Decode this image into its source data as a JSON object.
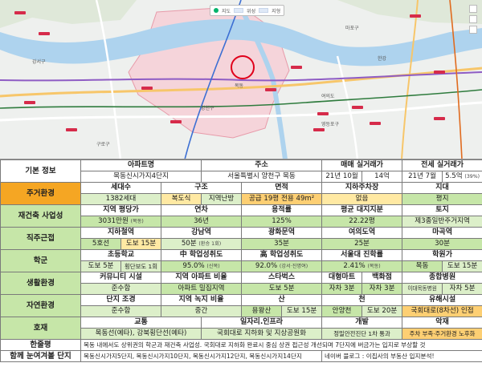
{
  "map": {
    "toolbar": [
      "지도",
      "위성",
      "지형"
    ],
    "labels": [
      "강서구",
      "양천구",
      "영등포구",
      "마포구",
      "구로구",
      "한강",
      "여의도",
      "목동"
    ]
  },
  "table": {
    "basic": {
      "cat": "기본 정보",
      "h_apt": "아파트명",
      "h_addr": "주소",
      "h_sale": "매매 실거래가",
      "h_jeon": "전세 실거래가",
      "apt": "목동신시가지4단지",
      "addr": "서울특별시 양천구 목동",
      "sale_date": "21년 10월",
      "sale_price": "14억",
      "jeon_date": "21년 7월",
      "jeon_price": "5.5억",
      "jeon_ratio": "(39%)"
    },
    "housing": {
      "cat": "주거환경",
      "h": [
        "세대수",
        "구조",
        "면적",
        "지하주차장",
        "지대"
      ],
      "households": "1382세대",
      "struct1": "복도식",
      "struct2": "지역난방",
      "area": "공급 19평 전용 49m²",
      "parking": "없음",
      "land": "평지"
    },
    "rebuild": {
      "cat": "재건축 사업성",
      "h": [
        "지역 평당가",
        "연차",
        "용적률",
        "평균 대지지분",
        "토지"
      ],
      "price": "3031만원",
      "price_note": "(목동)",
      "age": "36년",
      "far": "125%",
      "share": "22.22평",
      "zone": "제3종일반주거지역"
    },
    "commute": {
      "cat": "직주근접",
      "h": [
        "지하철역",
        "강남역",
        "광화문역",
        "여의도역",
        "마곡역"
      ],
      "line": "5호선",
      "walk": "도보 15분",
      "gangnam": "50분",
      "gangnam_note": "(환승 1회)",
      "gwanghwamun": "35분",
      "yeouido": "25분",
      "magok": "30분"
    },
    "school": {
      "cat": "학군",
      "h": [
        "초등학교",
        "中 학업성취도",
        "高 학업성취도",
        "서울대 진학률",
        "학원가"
      ],
      "elem": "도보 5분",
      "elem_note": "횡단보도 1회",
      "mid": "95.0%",
      "mid_note": "(신목)",
      "high": "92.0%",
      "high_note": "(강서·진명여)",
      "snu": "2.41%",
      "snu_note": "(목동)",
      "academy_area": "목동",
      "academy_walk": "도보 15분"
    },
    "living": {
      "cat": "생활환경",
      "h": [
        "커뮤니티 시설",
        "지역 아파트 비율",
        "스타벅스",
        "대형마트",
        "백화점",
        "종합병원"
      ],
      "community": "준수함",
      "apt_ratio": "아파트 밀집지역",
      "starbucks": "도보 5분",
      "mart": "자차 3분",
      "dept": "자차 3분",
      "hospital": "이대목동병원",
      "hospital_time": "자차 5분"
    },
    "nature": {
      "cat": "자연환경",
      "h": [
        "단지 조경",
        "지역 녹지 비율",
        "산",
        "천",
        "유해시설"
      ],
      "landscape": "준수함",
      "green": "중간",
      "mountain": "용왕산",
      "mountain_walk": "도보 15분",
      "stream": "안양천",
      "stream_walk": "도보 20분",
      "hazard": "국회대로(8차선) 인접"
    },
    "positive": {
      "cat": "호재",
      "h": [
        "교통",
        "일자리.인프라",
        "개발",
        "악재"
      ],
      "traffic": "목동선(예타), 강북횡단선(예타)",
      "jobs": "국회대로 지하화 및 지상공원화",
      "dev": "정밀안전진단 1차 통과",
      "bad": "주차 부족·주거환경 노후화"
    },
    "review": {
      "cat1": "한줄평",
      "cat2": "함께 눈여겨볼 단지",
      "text": "목동 내에서도 상위권의 학군과 재건축 사업성. 국회대로 지하화 완료시 중심 상권 접근성 개선되며 7단지에 버금가는 입지로 부상할 것",
      "complexes": "목동신시가지5단지, 목동신시가지10단지, 목동신시가지12단지, 목동신시가지14단지",
      "source": "네이버 블로그 : 이집사의 부동산 입지분석!"
    }
  }
}
